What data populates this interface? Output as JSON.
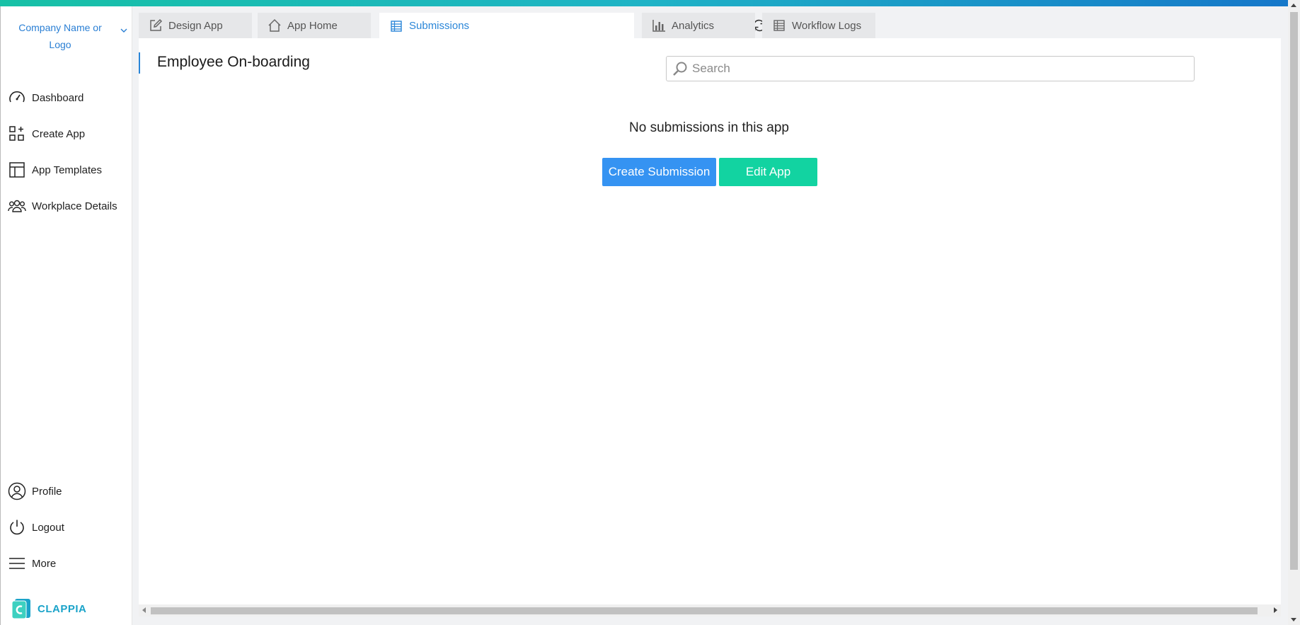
{
  "sidebar": {
    "company": "Company Name or Logo",
    "nav": [
      {
        "label": "Dashboard",
        "icon": "gauge-icon"
      },
      {
        "label": "Create App",
        "icon": "grid-plus-icon"
      },
      {
        "label": "App Templates",
        "icon": "layout-icon"
      },
      {
        "label": "Workplace Details",
        "icon": "users-icon"
      }
    ],
    "bottom_nav": [
      {
        "label": "Profile",
        "icon": "user-circle-icon"
      },
      {
        "label": "Logout",
        "icon": "power-icon"
      },
      {
        "label": "More",
        "icon": "menu-icon"
      }
    ],
    "brand": "CLAPPIA"
  },
  "tabs": [
    {
      "label": "Design App",
      "icon": "edit-icon"
    },
    {
      "label": "App Home",
      "icon": "home-icon"
    },
    {
      "label": "Submissions",
      "icon": "table-icon",
      "active": true
    },
    {
      "label": "Analytics",
      "icon": "bar-chart-icon"
    },
    {
      "label": "Workflow Logs",
      "icon": "table-icon"
    }
  ],
  "toolbar_icons": [
    "download-icon",
    "refresh-icon",
    "settings-icon",
    "import-icon",
    "edit-icon",
    "link-icon",
    "code-icon",
    "copy-icon"
  ],
  "main": {
    "title": "Employee On-boarding",
    "search_placeholder": "Search",
    "empty_message": "No submissions in this app",
    "create_button": "Create Submission",
    "edit_button": "Edit App"
  },
  "colors": {
    "accent": "#2a86d8",
    "primary_button": "#3593f2",
    "secondary_button": "#12d3a1",
    "brand": "#1aa3c9"
  }
}
